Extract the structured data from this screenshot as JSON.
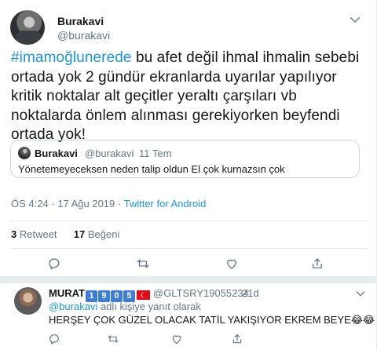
{
  "tweet": {
    "name": "Burakavi",
    "handle": "@burakavi",
    "hashtag": "#imamoğlunerede",
    "text": " bu afet değil ihmal ihmalin sebebi ortada yok 2 gündür ekranlarda uyarılar yapılıyor kritik noktalar alt geçitler yeraltı çarşıları vb noktalarda önlem alınması gerekiyorken beyfendi ortada yok!",
    "timestamp": "ÖS 4:24 · 17 Ağu 2019 · ",
    "source": "Twitter for Android"
  },
  "quote": {
    "name": "Burakavi",
    "handle": "@burakavi",
    "dot": "·",
    "time": "11 Tem",
    "text": "Yönetemeyeceksen neden talip oldun El çok kurnazsın çok"
  },
  "stats": {
    "retweets_count": "3",
    "retweets_label": " Retweet",
    "likes_count": "17",
    "likes_label": " Beğeni"
  },
  "reply": {
    "name": "MURAT",
    "digits": [
      "1",
      "9",
      "0",
      "5"
    ],
    "flag": "☾",
    "handle": "@GLTSRY19055234",
    "dot": "·",
    "time": "21d",
    "replying_prefix": "",
    "replying_to": "@burakavi",
    "replying_suffix": " adlı kişiye yanıt olarak",
    "text": "HERŞEY ÇOK GÜZEL OLACAK  TATİL YAKIŞIYOR EKREM BEYE😂😂"
  },
  "icons": [
    "chevron-down-icon",
    "reply-icon",
    "retweet-icon",
    "like-icon",
    "share-icon"
  ],
  "colors": {
    "link": "#1b95e0",
    "muted": "#657786",
    "text": "#14171a",
    "border": "#e6ecf0"
  }
}
